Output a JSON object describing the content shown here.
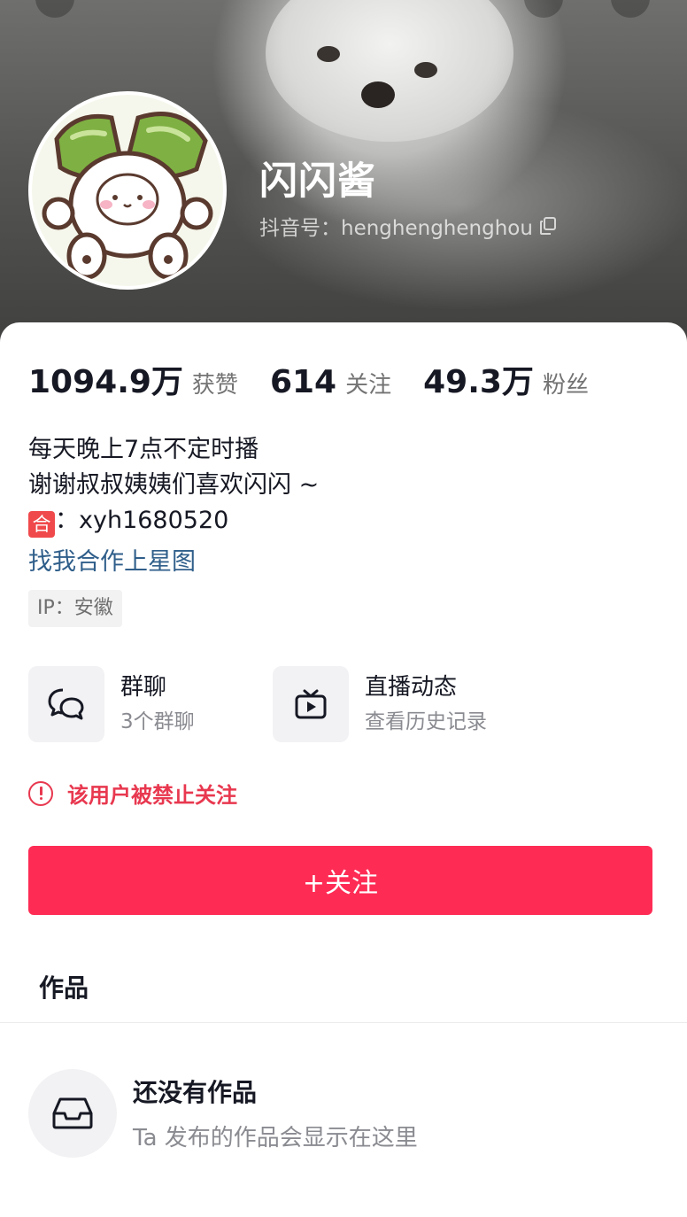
{
  "profile": {
    "nickname": "闪闪酱",
    "douyin_id": "抖音号：henghenghenghou"
  },
  "stats": [
    {
      "value": "1094.9万",
      "label": "获赞"
    },
    {
      "value": "614",
      "label": "关注"
    },
    {
      "value": "49.3万",
      "label": "粉丝"
    }
  ],
  "bio": {
    "line1": "每天晚上7点不定时播",
    "line2": "谢谢叔叔姨姨们喜欢闪闪 ~",
    "badge": "合",
    "line3": "：xyh1680520",
    "xingtu_link": "找我合作上星图",
    "ip": "IP：安徽"
  },
  "entries": {
    "group_chat": {
      "title": "群聊",
      "subtitle": "3个群聊",
      "icon": "chat-bubbles-icon"
    },
    "live": {
      "title": "直播动态",
      "subtitle": "查看历史记录",
      "icon": "tv-icon"
    }
  },
  "notice": {
    "text": "该用户被禁止关注",
    "icon": "exclamation-circle-icon"
  },
  "actions": {
    "follow_label": "+关注"
  },
  "tabs": {
    "works": "作品"
  },
  "empty_state": {
    "title": "还没有作品",
    "subtitle": "Ta 发布的作品会显示在这里",
    "icon": "inbox-tray-icon"
  },
  "colors": {
    "accent": "#fe2c55",
    "notice": "#e8384f",
    "link": "#2f5e8a"
  }
}
